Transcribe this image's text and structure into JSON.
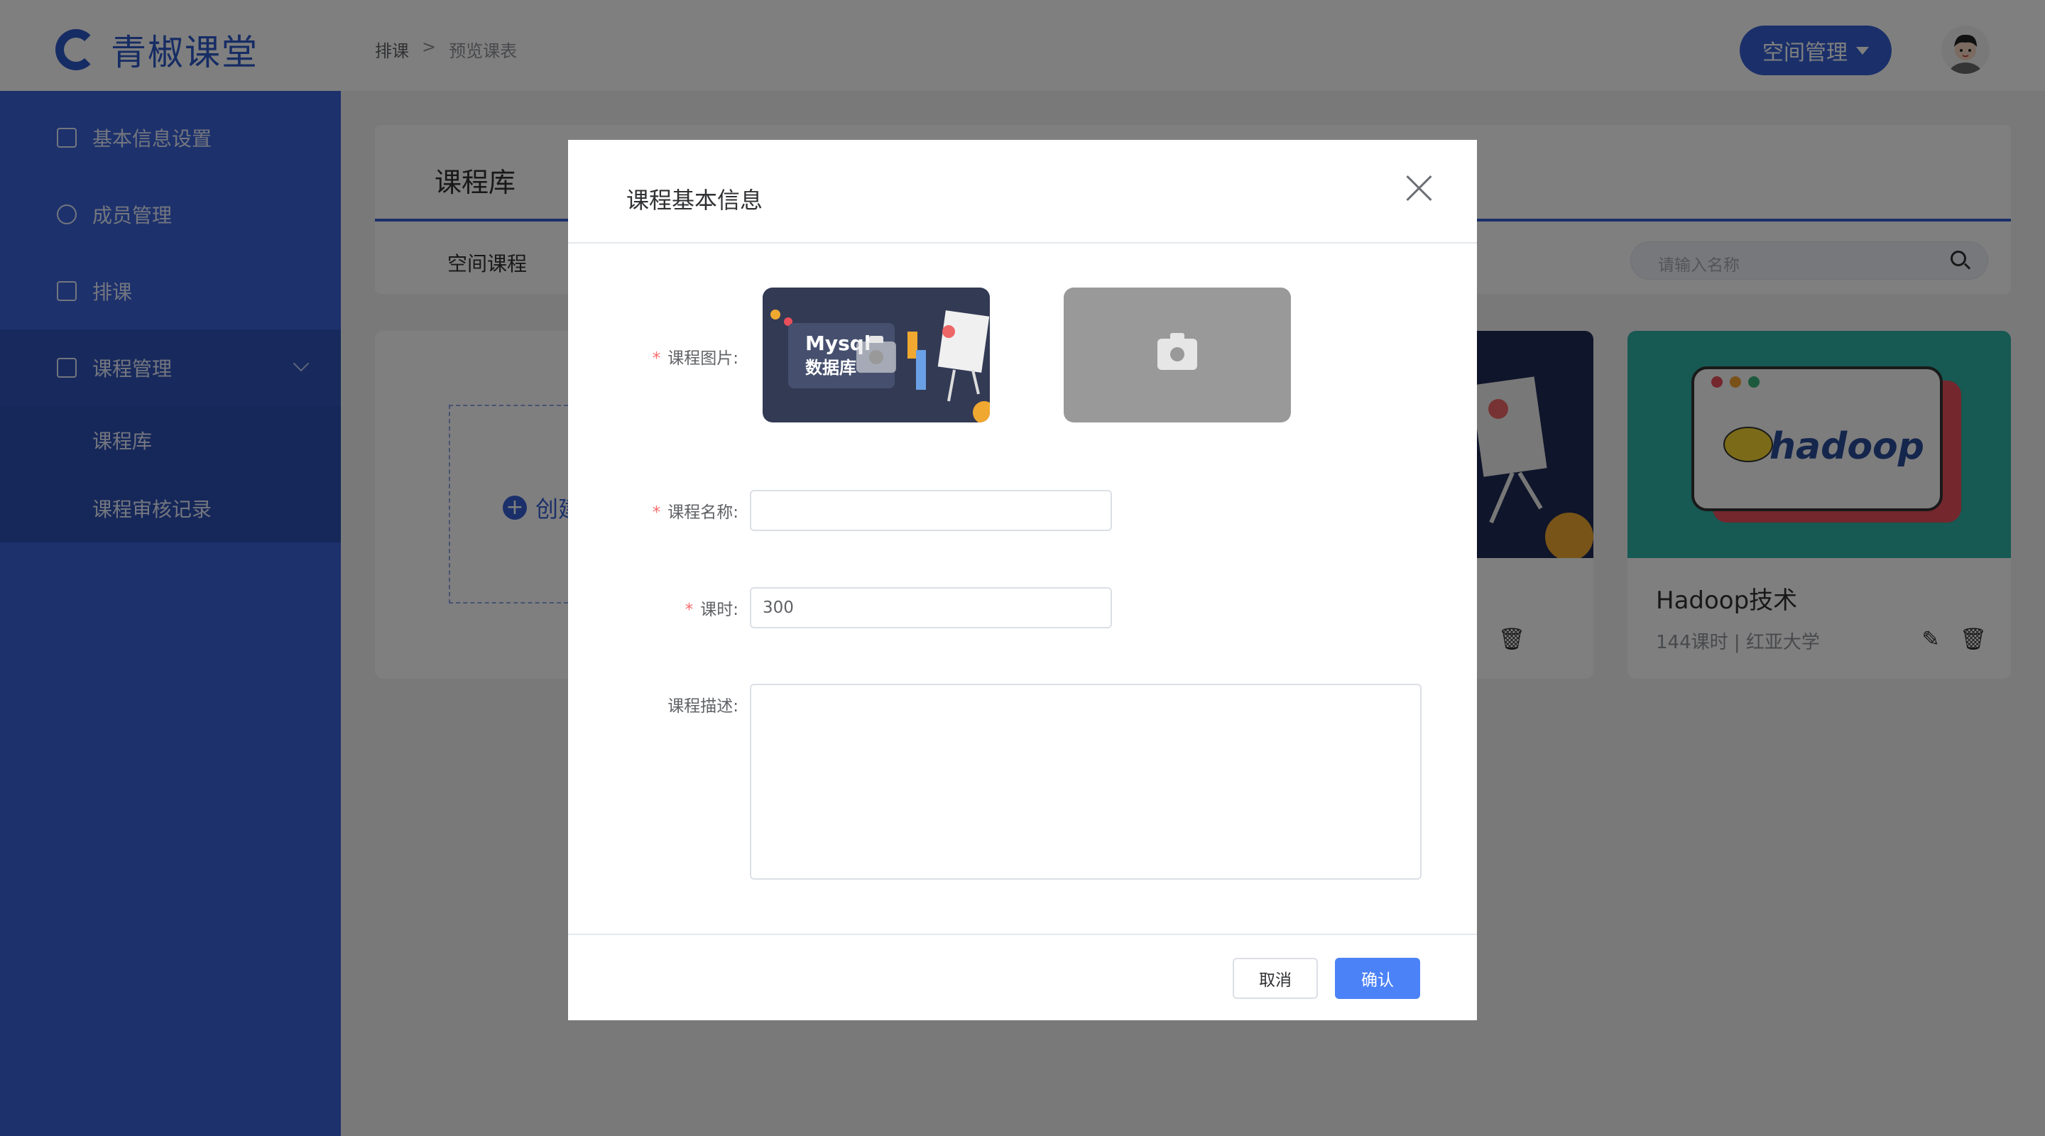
{
  "header": {
    "logo_text": "青椒课堂",
    "breadcrumb": [
      "排课",
      "预览课表"
    ],
    "breadcrumb_sep": ">",
    "space_button": "空间管理"
  },
  "sidebar": {
    "items": [
      {
        "label": "基本信息设置",
        "icon": "monitor-icon"
      },
      {
        "label": "成员管理",
        "icon": "user-icon"
      },
      {
        "label": "排课",
        "icon": "calendar-icon"
      },
      {
        "label": "课程管理",
        "icon": "calendar-icon"
      }
    ],
    "subitems": [
      {
        "label": "课程库"
      },
      {
        "label": "课程审核记录"
      }
    ]
  },
  "main": {
    "title": "课程库",
    "tab": "空间课程",
    "search_placeholder": "请输入名称",
    "create_label": "创建",
    "cards": [
      {
        "name": "Hadoop技术",
        "meta": "144课时 | 红亚大学",
        "image_text": "hadoop"
      }
    ]
  },
  "modal": {
    "title": "课程基本信息",
    "image_label": "课程图片:",
    "image_text_line1": "Mysql",
    "image_text_line2": "数据库",
    "name_label": "课程名称:",
    "name_value": "",
    "hours_label": "课时:",
    "hours_value": "300",
    "desc_label": "课程描述:",
    "desc_value": "",
    "cancel_label": "取消",
    "confirm_label": "确认"
  },
  "colors": {
    "accent": "#3660d4",
    "sidebar": "#3a63d8",
    "confirm": "#4c82f7",
    "required": "#f56c6c"
  }
}
